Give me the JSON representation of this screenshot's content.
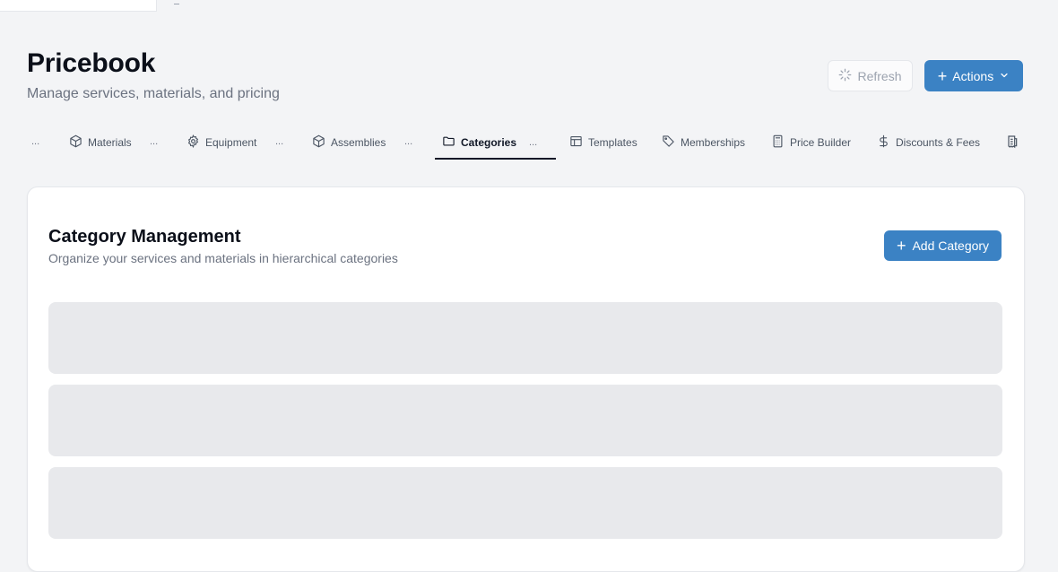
{
  "page": {
    "title": "Pricebook",
    "subtitle": "Manage services, materials, and pricing"
  },
  "header_actions": {
    "refresh_label": "Refresh",
    "actions_label": "Actions"
  },
  "tabs": {
    "overflow_marker": "...",
    "items": [
      {
        "label": "Materials",
        "icon": "box-icon"
      },
      {
        "label": "Equipment",
        "icon": "gear-icon"
      },
      {
        "label": "Assemblies",
        "icon": "box-icon"
      },
      {
        "label": "Categories",
        "icon": "folder-icon",
        "active": true
      },
      {
        "label": "Templates",
        "icon": "layout-icon"
      },
      {
        "label": "Memberships",
        "icon": "tag-icon"
      },
      {
        "label": "Price Builder",
        "icon": "calculator-icon"
      },
      {
        "label": "Discounts & Fees",
        "icon": "dollar-icon"
      }
    ],
    "trailing_icon": "receipt-icon"
  },
  "category_card": {
    "title": "Category Management",
    "description": "Organize your services and materials in hierarchical categories",
    "add_button_label": "Add Category"
  },
  "colors": {
    "primary": "#3b82c4",
    "background": "#f3f4f6",
    "skeleton": "#e8e9ec"
  }
}
